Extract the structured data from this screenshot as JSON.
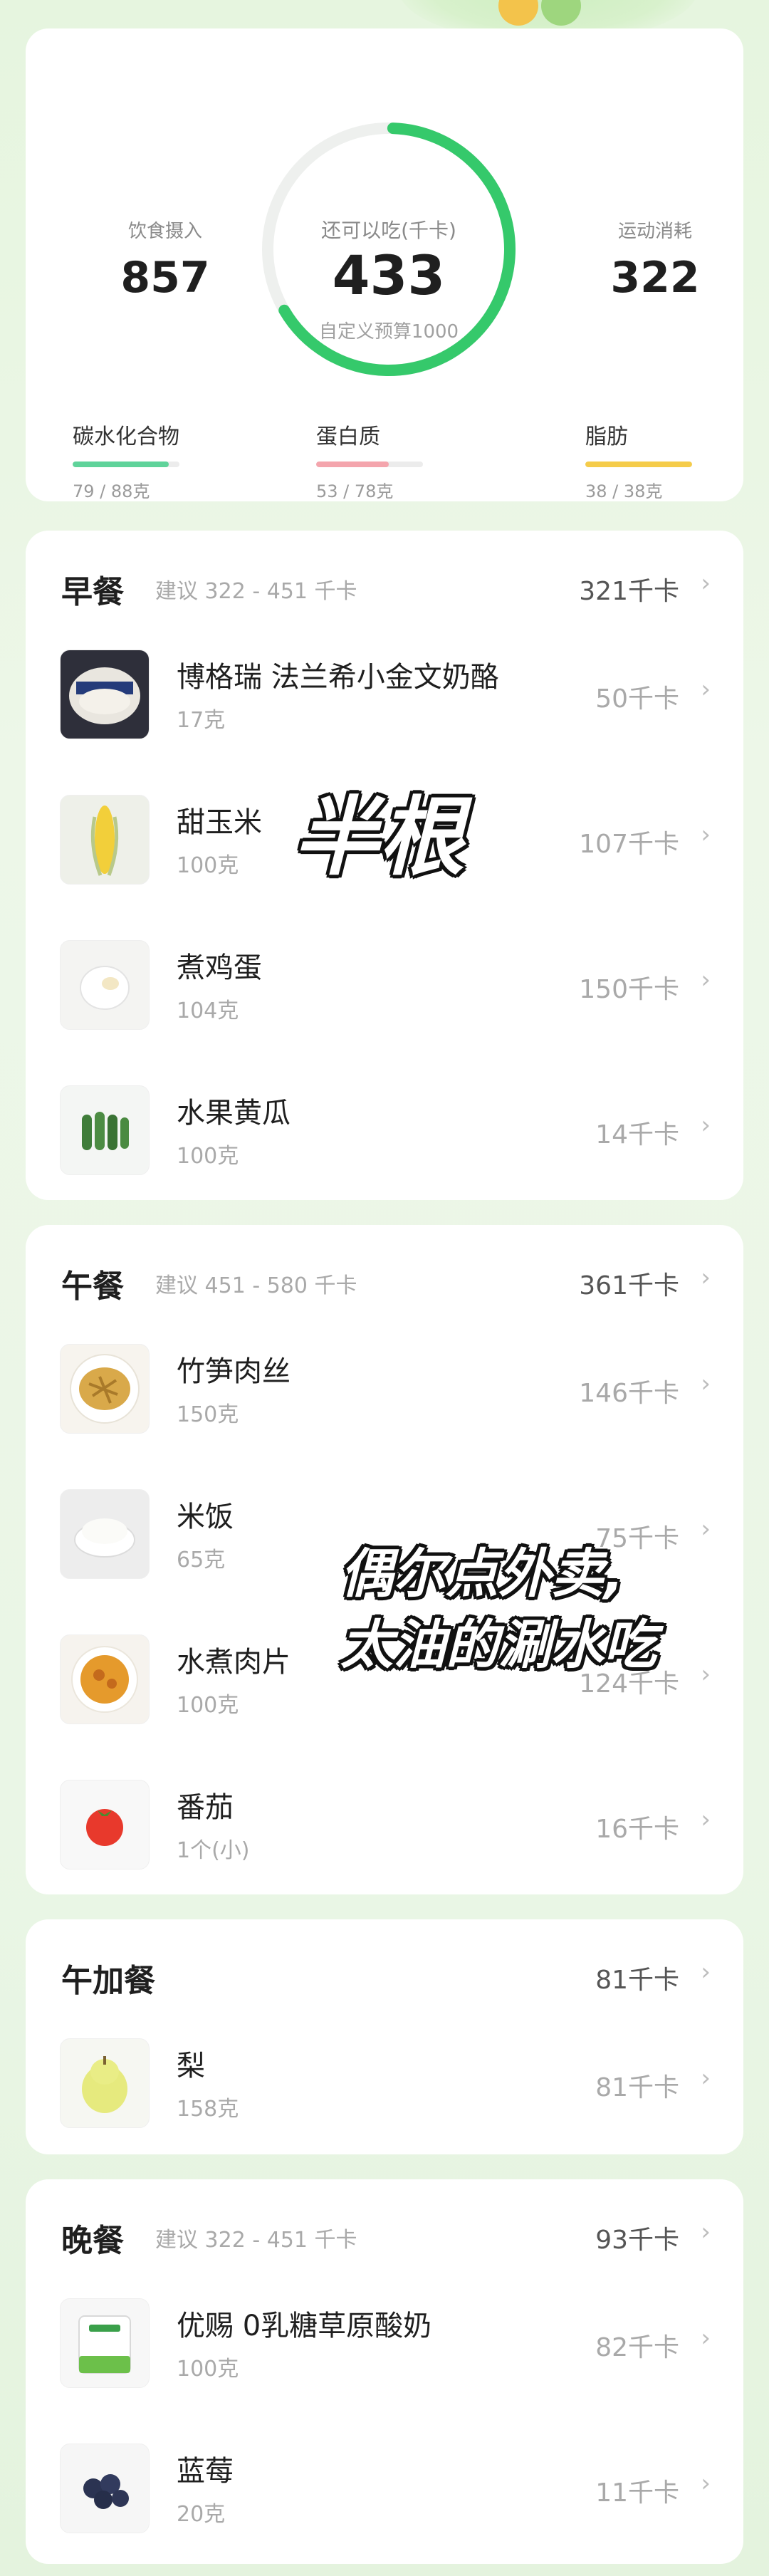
{
  "summary": {
    "intake_label": "饮食摄入",
    "intake_value": "857",
    "remaining_label": "还可以吃(千卡)",
    "remaining_value": "433",
    "budget_text": "自定义预算1000",
    "exercise_label": "运动消耗",
    "exercise_value": "322",
    "ring_progress": 0.66,
    "ring_color": "#35c96b",
    "macros": [
      {
        "name": "碳水化合物",
        "value": "79 / 88克",
        "fraction": 0.9,
        "color": "#5fd39a"
      },
      {
        "name": "蛋白质",
        "value": "53 / 78克",
        "fraction": 0.68,
        "color": "#f4a5ad"
      },
      {
        "name": "脂肪",
        "value": "38 / 38克",
        "fraction": 1.0,
        "color": "#f5cc4a"
      }
    ]
  },
  "meals": [
    {
      "title": "早餐",
      "suggest": "建议 322 - 451 千卡",
      "total": "321千卡",
      "foods": [
        {
          "name": "博格瑞 法兰希小金文奶酪",
          "amount": "17克",
          "kcal": "50千卡",
          "icon": "cheese-icon"
        },
        {
          "name": "甜玉米",
          "amount": "100克",
          "kcal": "107千卡",
          "icon": "corn-icon"
        },
        {
          "name": "煮鸡蛋",
          "amount": "104克",
          "kcal": "150千卡",
          "icon": "egg-icon"
        },
        {
          "name": "水果黄瓜",
          "amount": "100克",
          "kcal": "14千卡",
          "icon": "cucumber-icon"
        }
      ]
    },
    {
      "title": "午餐",
      "suggest": "建议 451 - 580 千卡",
      "total": "361千卡",
      "foods": [
        {
          "name": "竹笋肉丝",
          "amount": "150克",
          "kcal": "146千卡",
          "icon": "bamboo-pork-icon"
        },
        {
          "name": "米饭",
          "amount": "65克",
          "kcal": "75千卡",
          "icon": "rice-icon"
        },
        {
          "name": "水煮肉片",
          "amount": "100克",
          "kcal": "124千卡",
          "icon": "boiled-pork-icon"
        },
        {
          "name": "番茄",
          "amount": "1个(小)",
          "kcal": "16千卡",
          "icon": "tomato-icon"
        }
      ]
    },
    {
      "title": "午加餐",
      "suggest": "",
      "total": "81千卡",
      "foods": [
        {
          "name": "梨",
          "amount": "158克",
          "kcal": "81千卡",
          "icon": "pear-icon"
        }
      ]
    },
    {
      "title": "晚餐",
      "suggest": "建议 322 - 451 千卡",
      "total": "93千卡",
      "foods": [
        {
          "name": "优赐 0乳糖草原酸奶",
          "amount": "100克",
          "kcal": "82千卡",
          "icon": "yogurt-icon"
        },
        {
          "name": "蓝莓",
          "amount": "20克",
          "kcal": "11千卡",
          "icon": "blueberry-icon"
        }
      ]
    }
  ],
  "overlays": {
    "corn_note": "半根",
    "lunch_note_line1": "偶尔点外卖,",
    "lunch_note_line2": "太油的涮水吃"
  },
  "chevron": "›"
}
